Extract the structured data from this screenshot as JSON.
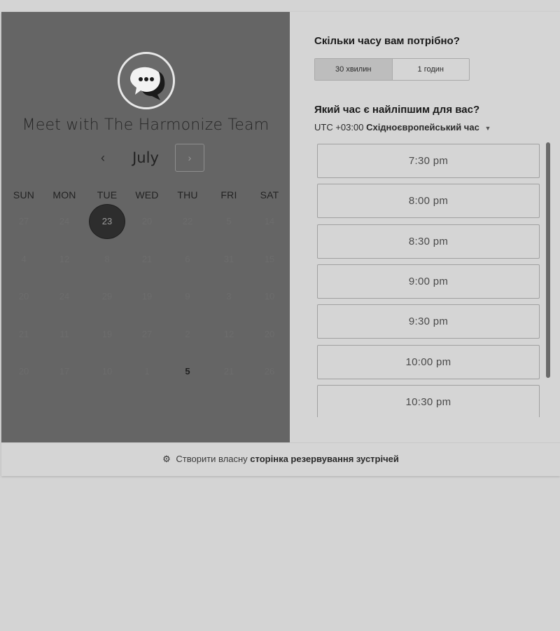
{
  "calendar": {
    "title": "Meet with The Harmonize Team",
    "month": "July",
    "prev_icon": "‹",
    "next_icon": "›",
    "weekdays": [
      "SUN",
      "MON",
      "TUE",
      "WED",
      "THU",
      "FRI",
      "SAT"
    ],
    "weeks": [
      [
        "27",
        "24",
        "23",
        "20",
        "22",
        "5",
        "14"
      ],
      [
        "4",
        "12",
        "8",
        "21",
        "6",
        "31",
        "15"
      ],
      [
        "20",
        "24",
        "29",
        "19",
        "9",
        "3",
        "10"
      ],
      [
        "21",
        "11",
        "19",
        "27",
        "2",
        "12",
        "20"
      ],
      [
        "20",
        "17",
        "10",
        "1",
        "5",
        "21",
        "26"
      ]
    ],
    "selected_day": "23",
    "available_day": "5"
  },
  "duration": {
    "question": "Скільки часу вам потрібно?",
    "options": [
      "30 хвилин",
      "1 годин"
    ],
    "selected": "30 хвилин"
  },
  "time": {
    "question": "Який час є найліпшим для вас?",
    "tz_offset": "UTC +03:00",
    "tz_name": "Східноєвропейський час",
    "slots": [
      "7:30 pm",
      "8:00 pm",
      "8:30 pm",
      "9:00 pm",
      "9:30 pm",
      "10:00 pm",
      "10:30 pm"
    ]
  },
  "footer": {
    "prefix": "Створити власну",
    "link": "сторінка резервування зустрічей"
  },
  "icons": {
    "avatar": "chat-bubble-icon",
    "footer": "sprocket-icon"
  }
}
